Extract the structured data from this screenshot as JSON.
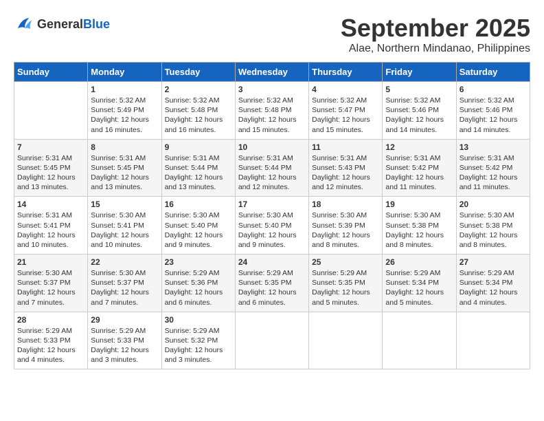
{
  "header": {
    "logo_general": "General",
    "logo_blue": "Blue",
    "month": "September 2025",
    "location": "Alae, Northern Mindanao, Philippines"
  },
  "days_of_week": [
    "Sunday",
    "Monday",
    "Tuesday",
    "Wednesday",
    "Thursday",
    "Friday",
    "Saturday"
  ],
  "weeks": [
    [
      {
        "day": "",
        "info": ""
      },
      {
        "day": "1",
        "info": "Sunrise: 5:32 AM\nSunset: 5:49 PM\nDaylight: 12 hours\nand 16 minutes."
      },
      {
        "day": "2",
        "info": "Sunrise: 5:32 AM\nSunset: 5:48 PM\nDaylight: 12 hours\nand 16 minutes."
      },
      {
        "day": "3",
        "info": "Sunrise: 5:32 AM\nSunset: 5:48 PM\nDaylight: 12 hours\nand 15 minutes."
      },
      {
        "day": "4",
        "info": "Sunrise: 5:32 AM\nSunset: 5:47 PM\nDaylight: 12 hours\nand 15 minutes."
      },
      {
        "day": "5",
        "info": "Sunrise: 5:32 AM\nSunset: 5:46 PM\nDaylight: 12 hours\nand 14 minutes."
      },
      {
        "day": "6",
        "info": "Sunrise: 5:32 AM\nSunset: 5:46 PM\nDaylight: 12 hours\nand 14 minutes."
      }
    ],
    [
      {
        "day": "7",
        "info": "Sunrise: 5:31 AM\nSunset: 5:45 PM\nDaylight: 12 hours\nand 13 minutes."
      },
      {
        "day": "8",
        "info": "Sunrise: 5:31 AM\nSunset: 5:45 PM\nDaylight: 12 hours\nand 13 minutes."
      },
      {
        "day": "9",
        "info": "Sunrise: 5:31 AM\nSunset: 5:44 PM\nDaylight: 12 hours\nand 13 minutes."
      },
      {
        "day": "10",
        "info": "Sunrise: 5:31 AM\nSunset: 5:44 PM\nDaylight: 12 hours\nand 12 minutes."
      },
      {
        "day": "11",
        "info": "Sunrise: 5:31 AM\nSunset: 5:43 PM\nDaylight: 12 hours\nand 12 minutes."
      },
      {
        "day": "12",
        "info": "Sunrise: 5:31 AM\nSunset: 5:42 PM\nDaylight: 12 hours\nand 11 minutes."
      },
      {
        "day": "13",
        "info": "Sunrise: 5:31 AM\nSunset: 5:42 PM\nDaylight: 12 hours\nand 11 minutes."
      }
    ],
    [
      {
        "day": "14",
        "info": "Sunrise: 5:31 AM\nSunset: 5:41 PM\nDaylight: 12 hours\nand 10 minutes."
      },
      {
        "day": "15",
        "info": "Sunrise: 5:30 AM\nSunset: 5:41 PM\nDaylight: 12 hours\nand 10 minutes."
      },
      {
        "day": "16",
        "info": "Sunrise: 5:30 AM\nSunset: 5:40 PM\nDaylight: 12 hours\nand 9 minutes."
      },
      {
        "day": "17",
        "info": "Sunrise: 5:30 AM\nSunset: 5:40 PM\nDaylight: 12 hours\nand 9 minutes."
      },
      {
        "day": "18",
        "info": "Sunrise: 5:30 AM\nSunset: 5:39 PM\nDaylight: 12 hours\nand 8 minutes."
      },
      {
        "day": "19",
        "info": "Sunrise: 5:30 AM\nSunset: 5:38 PM\nDaylight: 12 hours\nand 8 minutes."
      },
      {
        "day": "20",
        "info": "Sunrise: 5:30 AM\nSunset: 5:38 PM\nDaylight: 12 hours\nand 8 minutes."
      }
    ],
    [
      {
        "day": "21",
        "info": "Sunrise: 5:30 AM\nSunset: 5:37 PM\nDaylight: 12 hours\nand 7 minutes."
      },
      {
        "day": "22",
        "info": "Sunrise: 5:30 AM\nSunset: 5:37 PM\nDaylight: 12 hours\nand 7 minutes."
      },
      {
        "day": "23",
        "info": "Sunrise: 5:29 AM\nSunset: 5:36 PM\nDaylight: 12 hours\nand 6 minutes."
      },
      {
        "day": "24",
        "info": "Sunrise: 5:29 AM\nSunset: 5:35 PM\nDaylight: 12 hours\nand 6 minutes."
      },
      {
        "day": "25",
        "info": "Sunrise: 5:29 AM\nSunset: 5:35 PM\nDaylight: 12 hours\nand 5 minutes."
      },
      {
        "day": "26",
        "info": "Sunrise: 5:29 AM\nSunset: 5:34 PM\nDaylight: 12 hours\nand 5 minutes."
      },
      {
        "day": "27",
        "info": "Sunrise: 5:29 AM\nSunset: 5:34 PM\nDaylight: 12 hours\nand 4 minutes."
      }
    ],
    [
      {
        "day": "28",
        "info": "Sunrise: 5:29 AM\nSunset: 5:33 PM\nDaylight: 12 hours\nand 4 minutes."
      },
      {
        "day": "29",
        "info": "Sunrise: 5:29 AM\nSunset: 5:33 PM\nDaylight: 12 hours\nand 3 minutes."
      },
      {
        "day": "30",
        "info": "Sunrise: 5:29 AM\nSunset: 5:32 PM\nDaylight: 12 hours\nand 3 minutes."
      },
      {
        "day": "",
        "info": ""
      },
      {
        "day": "",
        "info": ""
      },
      {
        "day": "",
        "info": ""
      },
      {
        "day": "",
        "info": ""
      }
    ]
  ]
}
